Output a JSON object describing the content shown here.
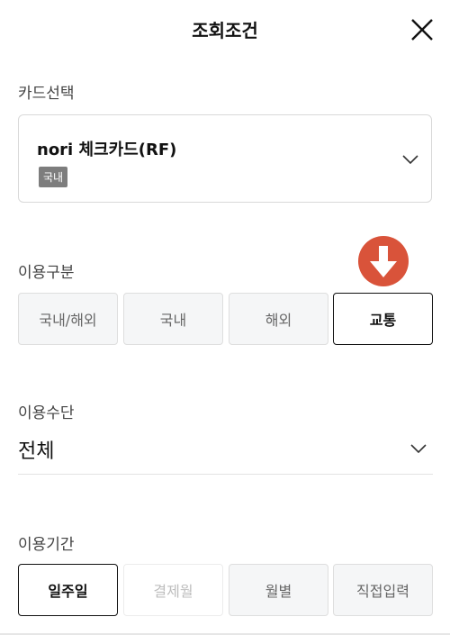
{
  "header": {
    "title": "조회조건"
  },
  "card_select": {
    "label": "카드선택",
    "card_name": "nori 체크카드(RF)",
    "badge": "국내"
  },
  "usage_type": {
    "label": "이용구분",
    "options": [
      {
        "label": "국내/해외",
        "selected": false
      },
      {
        "label": "국내",
        "selected": false
      },
      {
        "label": "해외",
        "selected": false
      },
      {
        "label": "교통",
        "selected": true
      }
    ]
  },
  "usage_means": {
    "label": "이용수단",
    "value": "전체"
  },
  "usage_period": {
    "label": "이용기간",
    "options": [
      {
        "label": "일주일",
        "selected": true,
        "disabled": false
      },
      {
        "label": "결제월",
        "selected": false,
        "disabled": true
      },
      {
        "label": "월별",
        "selected": false,
        "disabled": false
      },
      {
        "label": "직접입력",
        "selected": false,
        "disabled": false
      }
    ]
  },
  "colors": {
    "accent_arrow": "#d9533a",
    "selected_border": "#111111"
  }
}
